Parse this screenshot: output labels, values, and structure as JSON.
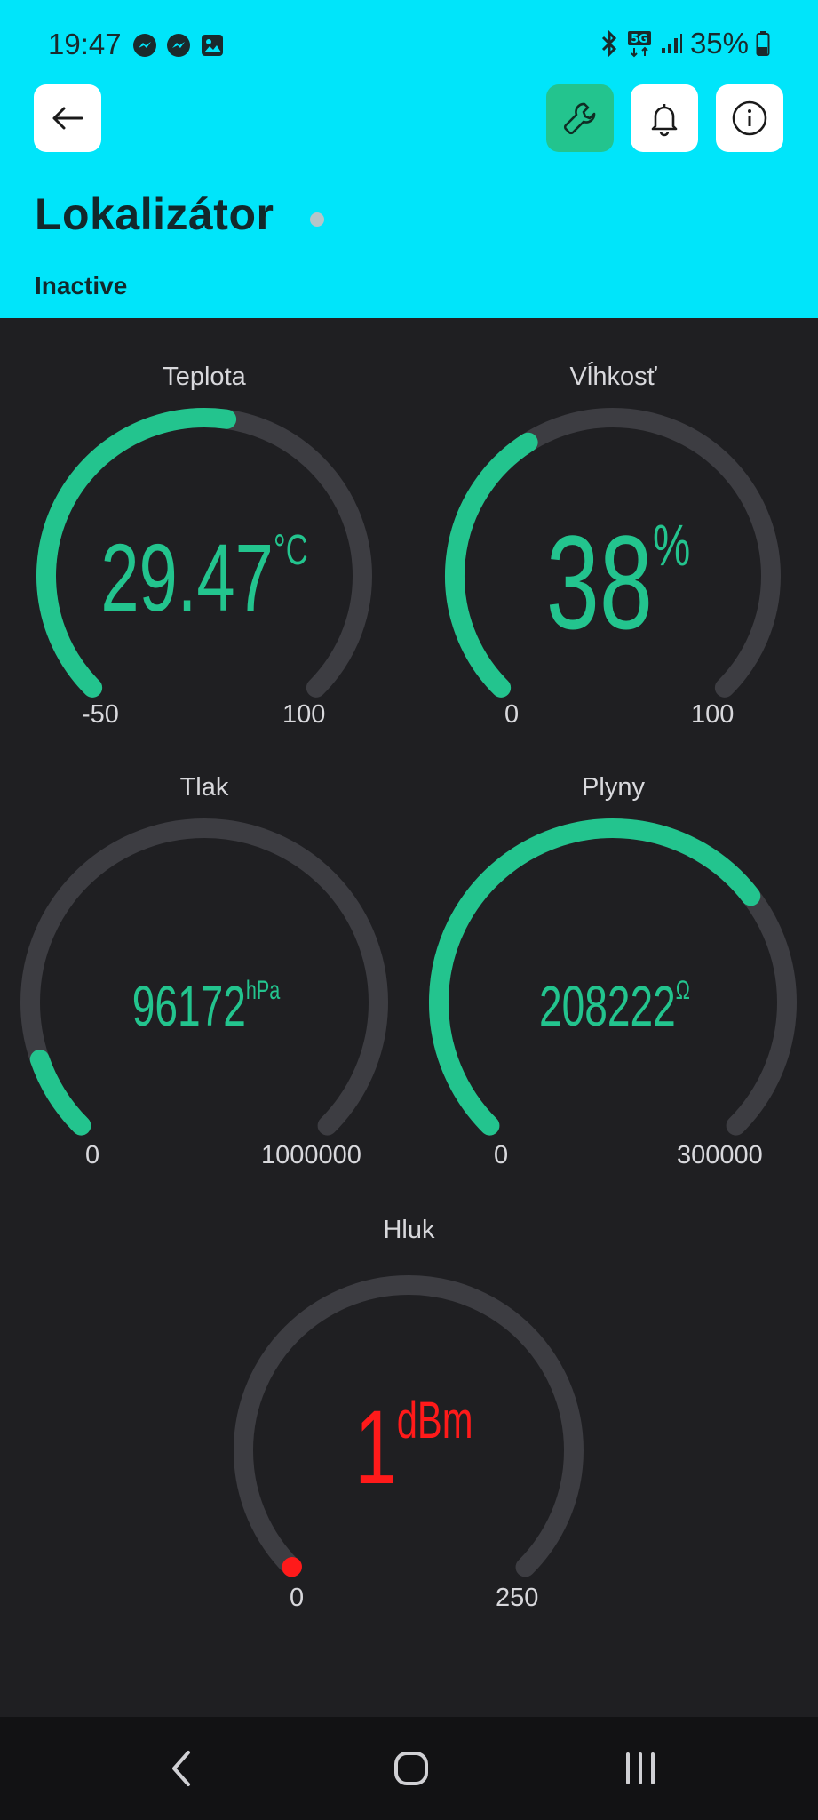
{
  "status_bar": {
    "time": "19:47",
    "battery": "35%",
    "icons": [
      "messenger-icon",
      "messenger-icon",
      "gallery-icon",
      "bluetooth-icon",
      "5g-icon",
      "signal-icon",
      "battery-icon"
    ]
  },
  "header": {
    "title": "Lokalizátor",
    "status": "Inactive",
    "buttons": [
      "back-arrow-icon",
      "wrench-icon",
      "bell-icon",
      "info-icon"
    ],
    "color": "#00e5fa"
  },
  "gauges": [
    {
      "id": "teplota",
      "label": "Teplota",
      "value": "29.47",
      "unit": "°C",
      "min": "-50",
      "max": "100",
      "level": 0.53,
      "color": "#23c48e"
    },
    {
      "id": "vlhkost",
      "label": "Vĺhkosť",
      "value": "38",
      "unit": "%",
      "min": "0",
      "max": "100",
      "level": 0.38,
      "color": "#23c48e"
    },
    {
      "id": "tlak",
      "label": "Tlak",
      "value": "96172",
      "unit": "hPa",
      "min": "0",
      "max": "1000000",
      "level": 0.096,
      "color": "#23c48e"
    },
    {
      "id": "plyny",
      "label": "Plyny",
      "value": "208222",
      "unit": "Ω",
      "min": "0",
      "max": "300000",
      "level": 0.694,
      "color": "#23c48e"
    },
    {
      "id": "hluk",
      "label": "Hluk",
      "value": "1",
      "unit": "dBm",
      "min": "0",
      "max": "250",
      "level": 0.004,
      "color": "#ff1a1a"
    }
  ],
  "nav": {
    "buttons": [
      "back-nav-icon",
      "home-nav-icon",
      "recents-nav-icon"
    ]
  }
}
